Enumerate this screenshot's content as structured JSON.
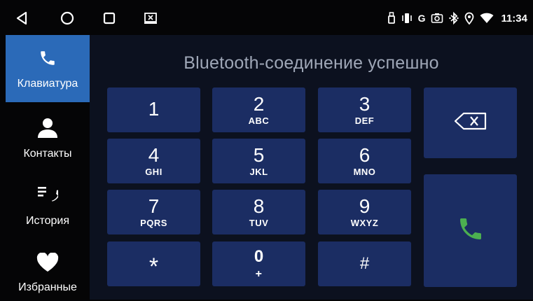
{
  "status": {
    "time": "11:34",
    "network_letter": "G"
  },
  "nav": {
    "icons": [
      "back-icon",
      "home-icon",
      "recents-icon",
      "screenshot-icon"
    ]
  },
  "sidebar": {
    "items": [
      {
        "label": "Клавиатура",
        "icon": "phone-icon",
        "active": true
      },
      {
        "label": "Контакты",
        "icon": "person-icon",
        "active": false
      },
      {
        "label": "История",
        "icon": "call-history-icon",
        "active": false
      },
      {
        "label": "Избранные",
        "icon": "heart-icon",
        "active": false
      }
    ]
  },
  "main": {
    "title": "Bluetooth-соединение успешно"
  },
  "keypad": {
    "keys": [
      {
        "digit": "1",
        "letters": ""
      },
      {
        "digit": "2",
        "letters": "ABC"
      },
      {
        "digit": "3",
        "letters": "DEF"
      },
      {
        "digit": "4",
        "letters": "GHI"
      },
      {
        "digit": "5",
        "letters": "JKL"
      },
      {
        "digit": "6",
        "letters": "MNO"
      },
      {
        "digit": "7",
        "letters": "PQRS"
      },
      {
        "digit": "8",
        "letters": "TUV"
      },
      {
        "digit": "9",
        "letters": "WXYZ"
      },
      {
        "digit": "*",
        "letters": ""
      },
      {
        "digit": "0",
        "letters": "+"
      },
      {
        "digit": "#",
        "letters": ""
      }
    ]
  },
  "colors": {
    "accent": "#2b6ab8",
    "key_bg": "#1b2d63",
    "call_green": "#4caf50"
  }
}
